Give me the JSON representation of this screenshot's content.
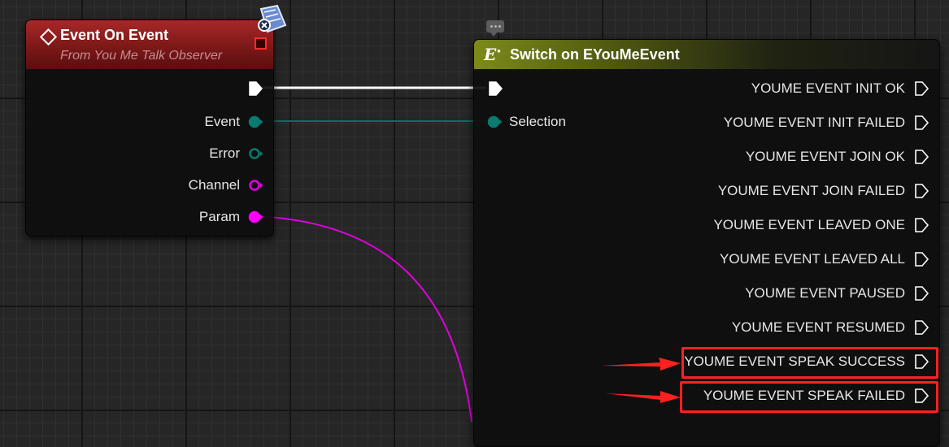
{
  "event_node": {
    "title": "Event On Event",
    "subtitle": "From You Me Talk Observer",
    "header_color": "#a82828",
    "pins": [
      {
        "label": "Event",
        "color": "#0b7a70",
        "kind": "enum"
      },
      {
        "label": "Error",
        "color": "#0b7a70",
        "kind": "enum-unconnected"
      },
      {
        "label": "Channel",
        "color": "#e000e0",
        "kind": "string-unconnected"
      },
      {
        "label": "Param",
        "color": "#ff00ff",
        "kind": "string"
      }
    ]
  },
  "switch_node": {
    "title": "Switch on EYouMeEvent",
    "header_color": "#7d8a1a",
    "input_label": "Selection",
    "outputs": [
      "YOUME EVENT INIT OK",
      "YOUME EVENT INIT FAILED",
      "YOUME EVENT JOIN OK",
      "YOUME EVENT JOIN FAILED",
      "YOUME EVENT LEAVED ONE",
      "YOUME EVENT LEAVED ALL",
      "YOUME EVENT PAUSED",
      "YOUME EVENT RESUMED",
      "YOUME EVENT SPEAK SUCCESS",
      "YOUME EVENT SPEAK FAILED"
    ],
    "highlighted_outputs": [
      "YOUME EVENT SPEAK SUCCESS",
      "YOUME EVENT SPEAK FAILED"
    ]
  },
  "icons": {
    "event_node": "event-diamond-icon",
    "switch_node": "switch-enum-icon",
    "delegate": "delegate-pin-icon",
    "server_badge": "server-replication-icon",
    "comment": "comment-bubble-icon",
    "annotation": "red-arrow-icon"
  },
  "colors": {
    "exec_wire": "#ffffff",
    "enum_wire": "#0b6f66",
    "string_wire": "#e000e0",
    "annotation": "#ff2020"
  }
}
